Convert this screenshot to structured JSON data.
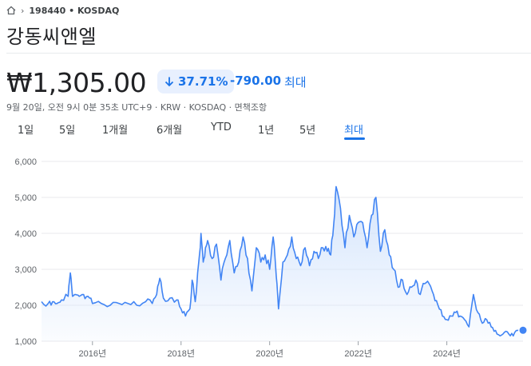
{
  "breadcrumb": {
    "home_icon": "home-icon",
    "chevron_icon": "chevron-right-icon",
    "ticker": "198440 • KOSDAQ"
  },
  "title": "강동씨앤엘",
  "price": "₩1,305.00",
  "change": {
    "arrow_icon": "arrow-down-icon",
    "percent": "37.71%",
    "absolute": "-790.00",
    "period": "최대"
  },
  "meta": "9월 20일, 오전 9시 0분 35초 UTC+9 · KRW · KOSDAQ · 면책조항",
  "tabs": [
    {
      "label": "1일"
    },
    {
      "label": "5일"
    },
    {
      "label": "1개월"
    },
    {
      "label": "6개월"
    },
    {
      "label": "YTD"
    },
    {
      "label": "1년"
    },
    {
      "label": "5년"
    },
    {
      "label": "최대"
    }
  ],
  "active_tab": "최대",
  "colors": {
    "line": "#4285f4",
    "accent": "#1a73e8",
    "fill_top": "#d2e3fc",
    "grid": "#e8eaed"
  },
  "chart_data": {
    "type": "area",
    "y_ticks": [
      "6,000",
      "5,000",
      "4,000",
      "3,000",
      "2,000",
      "1,000"
    ],
    "y_tick_values": [
      6000,
      5000,
      4000,
      3000,
      2000,
      1000
    ],
    "x_ticks": [
      "2016년",
      "2018년",
      "2020년",
      "2022년",
      "2024년"
    ],
    "x_tick_values": [
      2016,
      2018,
      2020,
      2022,
      2024
    ],
    "ylim": [
      1000,
      6000
    ],
    "xlim": [
      2014.85,
      2025.72
    ],
    "x": [
      2014.85,
      2015.0,
      2015.1,
      2015.2,
      2015.3,
      2015.45,
      2015.5,
      2015.55,
      2015.62,
      2015.7,
      2015.8,
      2015.9,
      2016.0,
      2016.2,
      2016.4,
      2016.6,
      2016.8,
      2017.0,
      2017.2,
      2017.35,
      2017.45,
      2017.52,
      2017.6,
      2017.75,
      2017.9,
      2018.0,
      2018.1,
      2018.2,
      2018.25,
      2018.32,
      2018.4,
      2018.45,
      2018.5,
      2018.55,
      2018.6,
      2018.7,
      2018.8,
      2018.9,
      2019.0,
      2019.1,
      2019.2,
      2019.3,
      2019.4,
      2019.5,
      2019.6,
      2019.7,
      2019.8,
      2019.9,
      2020.0,
      2020.08,
      2020.15,
      2020.2,
      2020.3,
      2020.4,
      2020.5,
      2020.6,
      2020.7,
      2020.8,
      2020.9,
      2021.0,
      2021.1,
      2021.2,
      2021.3,
      2021.38,
      2021.45,
      2021.5,
      2021.6,
      2021.7,
      2021.8,
      2021.9,
      2022.0,
      2022.1,
      2022.2,
      2022.3,
      2022.4,
      2022.5,
      2022.6,
      2022.7,
      2022.8,
      2022.9,
      2023.0,
      2023.1,
      2023.2,
      2023.3,
      2023.4,
      2023.5,
      2023.6,
      2023.7,
      2023.8,
      2023.9,
      2024.0,
      2024.1,
      2024.2,
      2024.3,
      2024.4,
      2024.5,
      2024.6,
      2024.7,
      2024.8,
      2024.9,
      2025.0,
      2025.1,
      2025.2,
      2025.3,
      2025.4,
      2025.5,
      2025.6,
      2025.72
    ],
    "values": [
      2100,
      2050,
      2100,
      2050,
      2150,
      2250,
      2900,
      2250,
      2300,
      2250,
      2300,
      2250,
      2050,
      2050,
      2000,
      2050,
      2050,
      2000,
      2100,
      2050,
      2300,
      2750,
      2200,
      2200,
      2150,
      1900,
      1700,
      1900,
      2700,
      2100,
      3200,
      4000,
      3200,
      3600,
      3800,
      3300,
      3700,
      2700,
      3300,
      3800,
      2900,
      3200,
      3900,
      3300,
      2400,
      3600,
      3200,
      3400,
      3000,
      3900,
      2800,
      1900,
      3200,
      3400,
      3900,
      3300,
      3100,
      3600,
      3100,
      3500,
      3300,
      3600,
      3500,
      3400,
      4300,
      5300,
      4700,
      3600,
      4500,
      3900,
      4300,
      4300,
      3600,
      4500,
      5000,
      3500,
      4100,
      3400,
      3000,
      2500,
      2700,
      2300,
      2500,
      2700,
      2300,
      2600,
      2600,
      2300,
      2000,
      1700,
      1600,
      1700,
      1800,
      1700,
      1600,
      1400,
      2300,
      1800,
      1500,
      1600,
      1400,
      1300,
      1150,
      1250,
      1200,
      1150,
      1300,
      1305
    ]
  }
}
